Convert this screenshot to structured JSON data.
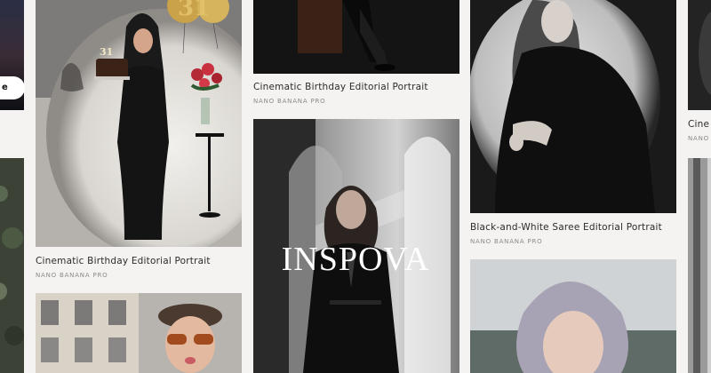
{
  "cards": [
    {
      "title": "Cinematic Birthday Editorial Portrait",
      "tag": "NANO BANANA PRO"
    },
    {
      "title": "Cinematic Birthday Editorial Portrait",
      "tag": "NANO BANANA PRO"
    },
    {
      "title": "Black-and-White Saree Editorial Portrait",
      "tag": "NANO BANANA PRO"
    },
    {
      "title": "Cine",
      "tag": "NANO"
    }
  ],
  "watermark": "INSPOVA",
  "left_pill_label": "e",
  "cake_number": "31",
  "balloon_numbers": "31"
}
